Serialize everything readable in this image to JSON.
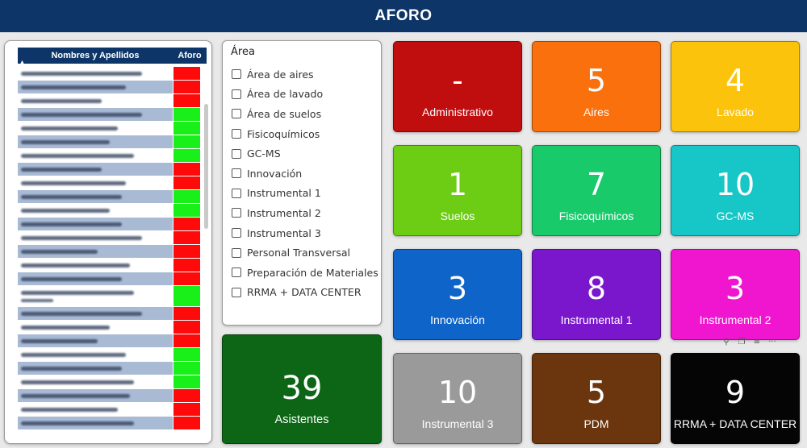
{
  "header": {
    "title": "AFORO"
  },
  "table": {
    "col_name": "Nombres y Apellidos",
    "col_aforo": "Aforo",
    "rows": [
      {
        "status": "red"
      },
      {
        "status": "red"
      },
      {
        "status": "red"
      },
      {
        "status": "green"
      },
      {
        "status": "green"
      },
      {
        "status": "green"
      },
      {
        "status": "green"
      },
      {
        "status": "red"
      },
      {
        "status": "red"
      },
      {
        "status": "green"
      },
      {
        "status": "green"
      },
      {
        "status": "red"
      },
      {
        "status": "red"
      },
      {
        "status": "red"
      },
      {
        "status": "red"
      },
      {
        "status": "red"
      },
      {
        "status": "green",
        "tall": true
      },
      {
        "status": "red"
      },
      {
        "status": "red"
      },
      {
        "status": "red"
      },
      {
        "status": "green"
      },
      {
        "status": "green"
      },
      {
        "status": "green"
      },
      {
        "status": "red"
      },
      {
        "status": "red"
      },
      {
        "status": "red"
      }
    ]
  },
  "filter": {
    "title": "Área",
    "items": [
      "Área de aires",
      "Área de lavado",
      "Área de suelos",
      "Fisicoquímicos",
      "GC-MS",
      "Innovación",
      "Instrumental 1",
      "Instrumental 2",
      "Instrumental 3",
      "Personal Transversal",
      "Preparación de Materiales",
      "RRMA + DATA CENTER"
    ]
  },
  "asistentes": {
    "value": "39",
    "label": "Asistentes"
  },
  "cards": [
    {
      "value": "-",
      "label": "Administrativo",
      "color": "#c00d0d"
    },
    {
      "value": "5",
      "label": "Aires",
      "color": "#f9700c"
    },
    {
      "value": "4",
      "label": "Lavado",
      "color": "#fbc30c"
    },
    {
      "value": "1",
      "label": "Suelos",
      "color": "#6ccd14"
    },
    {
      "value": "7",
      "label": "Fisicoquímicos",
      "color": "#19ca6b"
    },
    {
      "value": "10",
      "label": "GC-MS",
      "color": "#17c6c6"
    },
    {
      "value": "3",
      "label": "Innovación",
      "color": "#0e64c9"
    },
    {
      "value": "8",
      "label": "Instrumental 1",
      "color": "#7a16cc"
    },
    {
      "value": "3",
      "label": "Instrumental 2",
      "color": "#f016cf"
    },
    {
      "value": "10",
      "label": "Instrumental 3",
      "color": "#9a9a9a"
    },
    {
      "value": "5",
      "label": "PDM",
      "color": "#6b350e"
    },
    {
      "value": "9",
      "label": "RRMA + DATA CENTER",
      "color": "#050505"
    }
  ],
  "colors": {
    "red": "#ff0a0a",
    "green": "#19f019",
    "header": "#0d3567"
  }
}
